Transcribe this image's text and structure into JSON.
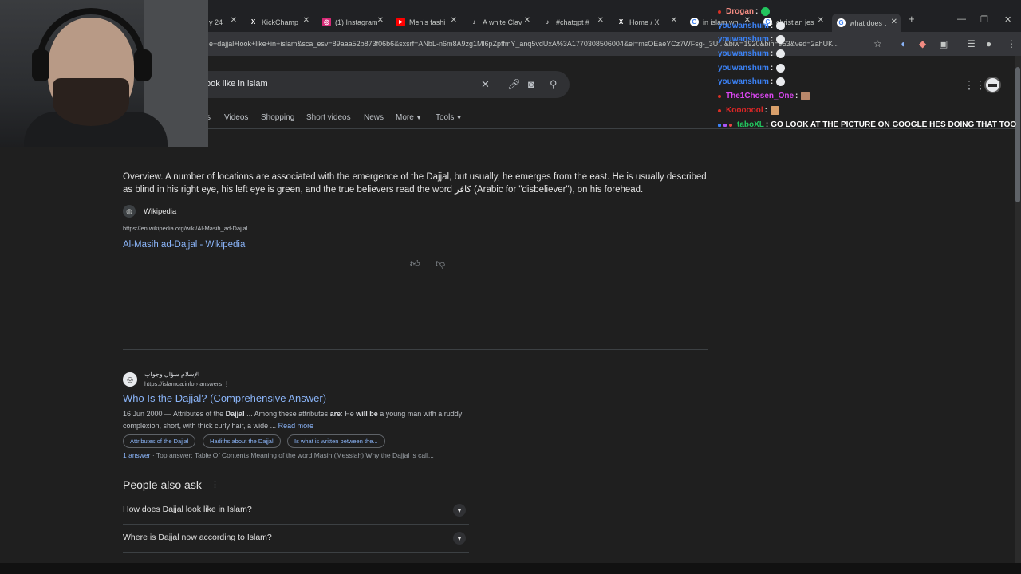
{
  "tabs": [
    {
      "title": "y 24",
      "icon": "",
      "color": "#202124"
    },
    {
      "title": "KickChamp",
      "icon": "X",
      "color": "#000000"
    },
    {
      "title": "(1) Instagram",
      "icon": "◎",
      "color": "#d62976"
    },
    {
      "title": "Men's fashi",
      "icon": "▶",
      "color": "#ff0000"
    },
    {
      "title": "A white Clav",
      "icon": "♪",
      "color": "#000000"
    },
    {
      "title": "#chatgpt #",
      "icon": "♪",
      "color": "#000000"
    },
    {
      "title": "Home / X",
      "icon": "X",
      "color": "#000000"
    },
    {
      "title": "in islam wh",
      "icon": "G",
      "color": "#ffffff"
    },
    {
      "title": "christian jes",
      "icon": "G",
      "color": "#ffffff"
    },
    {
      "title": "what does t",
      "icon": "G",
      "color": "#ffffff"
    }
  ],
  "address_bar": {
    "url": "e+dajjal+look+like+in+islam&sca_esv=89aaa52b873f06b6&sxsrf=ANbL-n6m8A9zg1Ml6pZpffmY_anq5vdUxA%3A1770308506004&ei=msOEaeYCz7WFsg-_3U...&biw=1920&bih=953&ved=2ahUK..."
  },
  "search": {
    "query": "ook like in islam",
    "nav": [
      "s",
      "Videos",
      "Shopping",
      "Short videos",
      "News",
      "More",
      "Tools"
    ]
  },
  "chat": [
    {
      "user": "Drogan",
      "color": "#d93025",
      "msg": ""
    },
    {
      "user": "youwanshum",
      "color": "#3b82f6",
      "msg": ""
    },
    {
      "user": "youwanshum",
      "color": "#3b82f6",
      "msg": ""
    },
    {
      "user": "youwanshum",
      "color": "#3b82f6",
      "msg": ""
    },
    {
      "user": "youwanshum",
      "color": "#3b82f6",
      "msg": ""
    },
    {
      "user": "youwanshum",
      "color": "#3b82f6",
      "msg": ""
    },
    {
      "user": "The1Chosen_One",
      "color": "#d946ef",
      "msg": ""
    },
    {
      "user": "Kooooool",
      "color": "#dc2626",
      "msg": ""
    },
    {
      "user": "taboXL",
      "color": "#22c55e",
      "msg": "GO LOOK AT THE PICTURE ON GOOGLE HES DOING THAT TOO"
    }
  ],
  "overview": {
    "text": "Overview. A number of locations are associated with the emergence of the Dajjal, but usually, he emerges from the east. He is usually described as blind in his right eye, his left eye is green, and the true believers read the word كافر (Arabic for \"disbeliever\"), on his forehead.",
    "source_name": "Wikipedia",
    "source_url": "https://en.wikipedia.org/wiki/Al-Masih_ad-Dajjal",
    "link_title": "Al-Masih ad-Dajjal - Wikipedia"
  },
  "result": {
    "site_name": "الإسلام سؤال وجواب",
    "cite": "https://islamqa.info › answers",
    "title": "Who Is the Dajjal? (Comprehensive Answer)",
    "date": "16 Jun 2000",
    "snippet_pre": " — Attributes of the ",
    "snippet_b1": "Dajjal",
    "snippet_mid": " ... Among these attributes ",
    "snippet_b2": "are",
    "snippet_mid2": ": He ",
    "snippet_b3": "will be",
    "snippet_post": " a young man with a ruddy complexion, short, with thick curly hair, a wide ...",
    "read_more": "Read more",
    "chips": [
      "Attributes of the Dajjal",
      "Hadiths about the Dajjal",
      "Is what is written between the..."
    ],
    "answer_count": "1 answer",
    "top_answer": " · Top answer: Table Of Contents Meaning of the word Masih (Messiah) Why the Dajjal is call..."
  },
  "people_also_ask": {
    "title": "People also ask",
    "questions": [
      "How does Dajjal look like in Islam?",
      "Where is Dajjal now according to Islam?"
    ]
  }
}
